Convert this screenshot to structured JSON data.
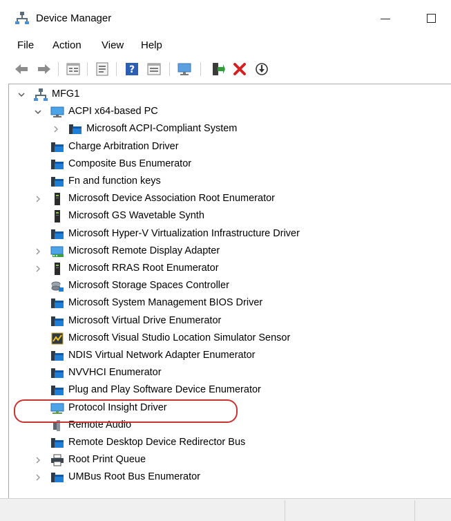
{
  "window": {
    "title": "Device Manager"
  },
  "menu": [
    "File",
    "Action",
    "View",
    "Help"
  ],
  "toolbar": [
    {
      "name": "back-icon"
    },
    {
      "name": "forward-icon"
    },
    {
      "name": "properties-icon"
    },
    {
      "name": "driver-details-icon"
    },
    {
      "name": "help-icon"
    },
    {
      "name": "show-hidden-icon"
    },
    {
      "name": "scan-hardware-icon"
    },
    {
      "name": "update-driver-icon"
    },
    {
      "name": "uninstall-icon"
    },
    {
      "name": "disable-device-icon"
    }
  ],
  "tree": [
    {
      "level": 0,
      "label": "MFG1",
      "expander": "expanded",
      "icon": "computer-icon"
    },
    {
      "level": 1,
      "label": "ACPI x64-based PC",
      "expander": "expanded",
      "icon": "monitor-icon"
    },
    {
      "level": 2,
      "label": "Microsoft ACPI-Compliant System",
      "expander": "collapsed",
      "icon": "system-device-icon"
    },
    {
      "level": 1,
      "label": "Charge Arbitration Driver",
      "expander": "none",
      "icon": "system-device-icon"
    },
    {
      "level": 1,
      "label": "Composite Bus Enumerator",
      "expander": "none",
      "icon": "system-device-icon"
    },
    {
      "level": 1,
      "label": "Fn and function keys",
      "expander": "none",
      "icon": "system-device-icon"
    },
    {
      "level": 1,
      "label": "Microsoft Device Association Root Enumerator",
      "expander": "collapsed",
      "icon": "tower-icon"
    },
    {
      "level": 1,
      "label": "Microsoft GS Wavetable Synth",
      "expander": "none",
      "icon": "tower-icon"
    },
    {
      "level": 1,
      "label": "Microsoft Hyper-V Virtualization Infrastructure Driver",
      "expander": "none",
      "icon": "system-device-icon"
    },
    {
      "level": 1,
      "label": "Microsoft Remote Display Adapter",
      "expander": "collapsed",
      "icon": "display-adapter-icon"
    },
    {
      "level": 1,
      "label": "Microsoft RRAS Root Enumerator",
      "expander": "collapsed",
      "icon": "tower-icon"
    },
    {
      "level": 1,
      "label": "Microsoft Storage Spaces Controller",
      "expander": "none",
      "icon": "storage-controller-icon"
    },
    {
      "level": 1,
      "label": "Microsoft System Management BIOS Driver",
      "expander": "none",
      "icon": "system-device-icon"
    },
    {
      "level": 1,
      "label": "Microsoft Virtual Drive Enumerator",
      "expander": "none",
      "icon": "system-device-icon"
    },
    {
      "level": 1,
      "label": "Microsoft Visual Studio Location Simulator Sensor",
      "expander": "none",
      "icon": "sensor-icon"
    },
    {
      "level": 1,
      "label": "NDIS Virtual Network Adapter Enumerator",
      "expander": "none",
      "icon": "system-device-icon"
    },
    {
      "level": 1,
      "label": "NVVHCI Enumerator",
      "expander": "none",
      "icon": "system-device-icon"
    },
    {
      "level": 1,
      "label": "Plug and Play Software Device Enumerator",
      "expander": "none",
      "icon": "system-device-icon"
    },
    {
      "level": 1,
      "label": "Protocol Insight Driver",
      "expander": "none",
      "icon": "network-monitor-icon",
      "highlighted": true
    },
    {
      "level": 1,
      "label": "Remote Audio",
      "expander": "none",
      "icon": "speaker-icon"
    },
    {
      "level": 1,
      "label": "Remote Desktop Device Redirector Bus",
      "expander": "none",
      "icon": "system-device-icon"
    },
    {
      "level": 1,
      "label": "Root Print Queue",
      "expander": "collapsed",
      "icon": "printer-icon"
    },
    {
      "level": 1,
      "label": "UMBus Root Bus Enumerator",
      "expander": "collapsed",
      "icon": "system-device-icon"
    }
  ],
  "colors": {
    "highlight_outline": "#c8332f",
    "icon_blue": "#1f6fbf"
  }
}
